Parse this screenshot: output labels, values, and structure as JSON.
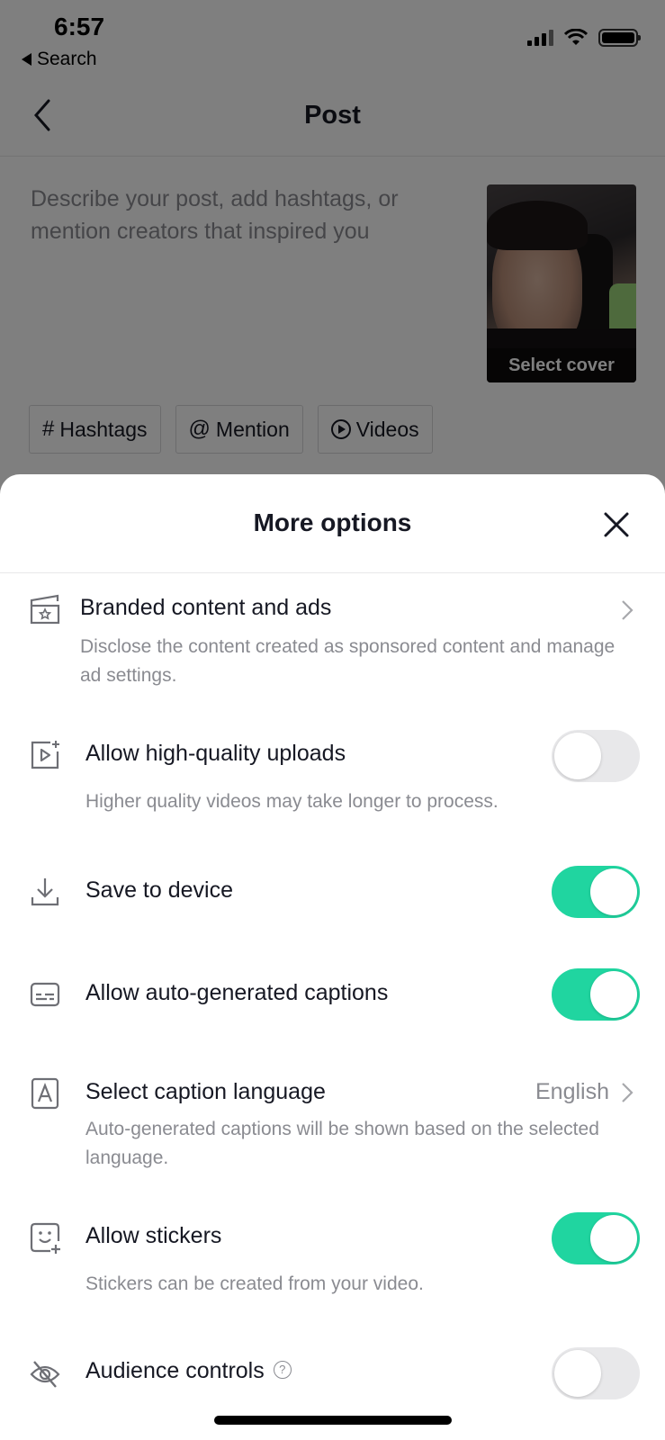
{
  "status_bar": {
    "time": "6:57",
    "back_app": "Search",
    "icons": [
      "cellular-signal-icon",
      "wifi-icon",
      "battery-icon"
    ]
  },
  "nav": {
    "title": "Post",
    "back_icon": "chevron-left-icon"
  },
  "post": {
    "description_placeholder": "Describe your post, add hashtags, or mention creators that inspired you",
    "cover_label": "Select cover",
    "chips": [
      {
        "glyph": "#",
        "label": "Hashtags",
        "icon": "hashtag-icon"
      },
      {
        "glyph": "@",
        "label": "Mention",
        "icon": "at-icon"
      },
      {
        "glyph": "",
        "label": "Videos",
        "icon": "play-circle-icon"
      }
    ]
  },
  "sheet": {
    "title": "More options",
    "close_icon": "close-icon",
    "options": [
      {
        "key": "branded",
        "icon": "clapperboard-star-icon",
        "title": "Branded content and ads",
        "description": "Disclose the content created as sponsored content and manage ad settings.",
        "control": "chevron"
      },
      {
        "key": "hq_uploads",
        "icon": "video-sparkle-icon",
        "title": "Allow high-quality uploads",
        "description": "Higher quality videos may take longer to process.",
        "control": "toggle",
        "enabled": false
      },
      {
        "key": "save_device",
        "icon": "download-icon",
        "title": "Save to device",
        "control": "toggle",
        "enabled": true
      },
      {
        "key": "auto_captions",
        "icon": "captions-icon",
        "title": "Allow auto-generated captions",
        "control": "toggle",
        "enabled": true
      },
      {
        "key": "caption_language",
        "icon": "letter-a-icon",
        "title": "Select caption language",
        "value": "English",
        "description": "Auto-generated captions will be shown based on the selected language.",
        "control": "chevron"
      },
      {
        "key": "stickers",
        "icon": "sticker-add-icon",
        "title": "Allow stickers",
        "description": "Stickers can be created from your video.",
        "control": "toggle",
        "enabled": true
      },
      {
        "key": "audience_controls",
        "icon": "eye-slash-icon",
        "title": "Audience controls",
        "help_glyph": "?",
        "control": "toggle",
        "enabled": false
      }
    ]
  },
  "colors": {
    "toggle_on": "#20d5a0",
    "toggle_off": "#e8e8ea",
    "primary_text": "#161823",
    "secondary_text": "#8a8b91"
  }
}
